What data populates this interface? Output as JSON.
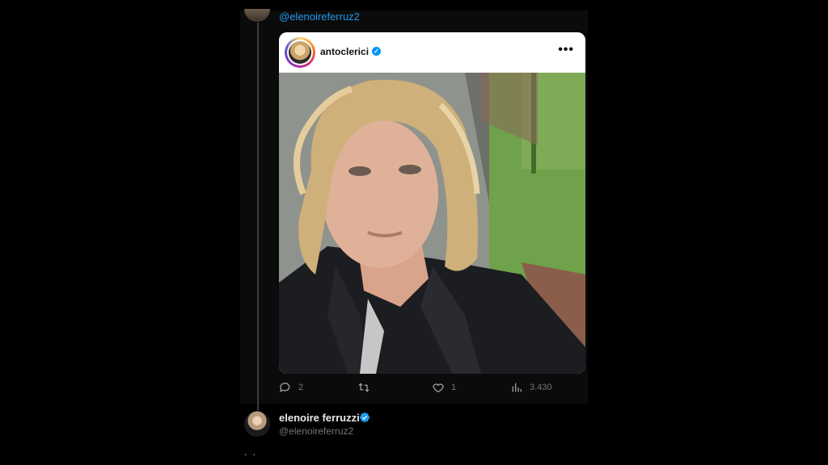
{
  "top_post": {
    "handle": "@elenoireferruz2"
  },
  "embed": {
    "username": "antoclerici",
    "more_icon": "more-horizontal-icon",
    "verified_icon": "verified-badge-icon",
    "photo_description": "selfie photo"
  },
  "actions": {
    "replies": "2",
    "retweets": "",
    "likes": "1",
    "views": "3.430"
  },
  "reply": {
    "display_name": "elenoire ferruzzi",
    "handle": "@elenoireferruz2",
    "text": ". ."
  },
  "colors": {
    "accent": "#1d9bf0",
    "muted": "#71767b",
    "ig_verified": "#0095f6"
  }
}
